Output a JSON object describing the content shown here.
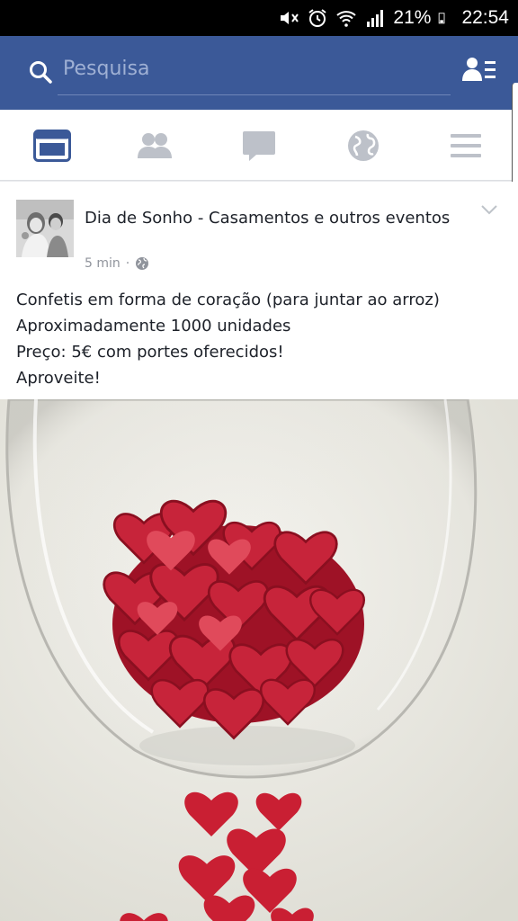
{
  "status_bar": {
    "battery_percent": "21%",
    "time": "22:54"
  },
  "header": {
    "search": {
      "placeholder": "Pesquisa"
    }
  },
  "tabs": [
    {
      "name": "news-feed",
      "icon": "news-feed-icon",
      "active": true
    },
    {
      "name": "friends",
      "icon": "friends-icon",
      "active": false
    },
    {
      "name": "messages",
      "icon": "chat-bubble-icon",
      "active": false
    },
    {
      "name": "notifications",
      "icon": "globe-icon",
      "active": false
    },
    {
      "name": "more",
      "icon": "menu-icon",
      "active": false
    }
  ],
  "post": {
    "author": "Dia de Sonho - Casamentos e outros eventos",
    "time": "5 min",
    "separator": "·",
    "privacy_icon": "globe-icon",
    "text_lines": [
      "Confetis em forma de coração (para juntar ao arroz)",
      "Aproximadamente 1000 unidades",
      "Preço: 5€ com portes oferecidos!",
      "Aproveite!"
    ]
  },
  "colors": {
    "brand_blue": "#3b5998",
    "active_tab": "#3b5998",
    "inactive_tab": "#bdc1c9"
  }
}
